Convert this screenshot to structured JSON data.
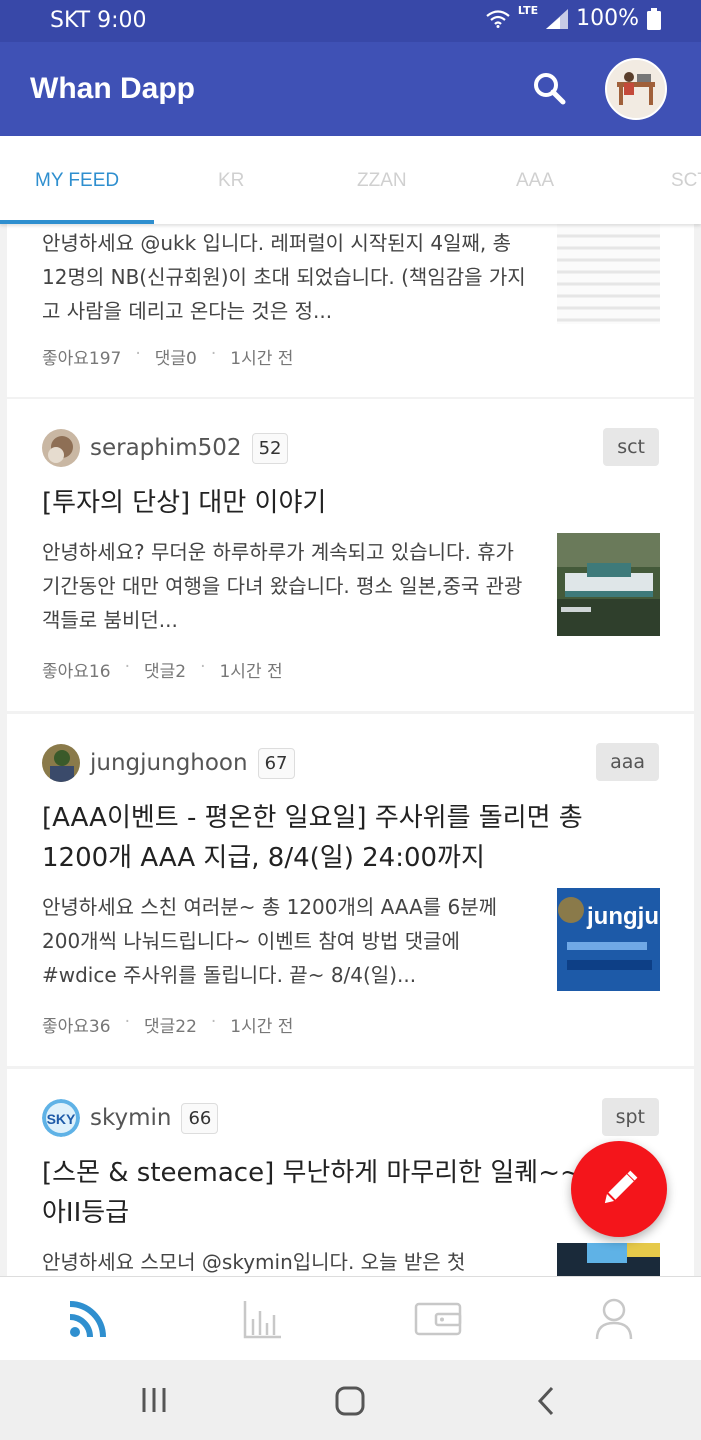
{
  "status": {
    "carrier": "SKT 9:00",
    "network": "LTE",
    "battery": "100%"
  },
  "app": {
    "title": "Whan Dapp"
  },
  "tabs": [
    {
      "label": "MY FEED",
      "active": true
    },
    {
      "label": "KR"
    },
    {
      "label": "ZZAN"
    },
    {
      "label": "AAA"
    },
    {
      "label": "SCT"
    }
  ],
  "posts": [
    {
      "excerpt": "안녕하세요 @ukk 입니다. 레퍼럴이 시작된지 4일째, 총 12명의 NB(신규회원)이 초대 되었습니다. (책임감을 가지고 사람을 데리고 온다는 것은 정...",
      "likes": "좋아요197",
      "comments": "댓글0",
      "time": "1시간 전"
    },
    {
      "author": "seraphim502",
      "rep": "52",
      "tag": "sct",
      "title": "[투자의 단상] 대만 이야기",
      "excerpt": "안녕하세요? 무더운 하루하루가 계속되고 있습니다. 휴가 기간동안 대만 여행을 다녀 왔습니다. 평소 일본,중국 관광객들로 붐비던...",
      "likes": "좋아요16",
      "comments": "댓글2",
      "time": "1시간 전"
    },
    {
      "author": "jungjunghoon",
      "rep": "67",
      "tag": "aaa",
      "title": "[AAA이벤트 - 평온한 일요일] 주사위를 돌리면 총 1200개 AAA 지급, 8/4(일) 24:00까지",
      "excerpt": "안녕하세요 스친 여러분~ 총 1200개의 AAA를 6분께 200개씩 나눠드립니다~ 이벤트 참여 방법 댓글에 #wdice 주사위를 돌립니다. 끝~ 8/4(일)...",
      "likes": "좋아요36",
      "comments": "댓글22",
      "time": "1시간 전",
      "thumb_text": "jungju"
    },
    {
      "author": "skymin",
      "rep": "66",
      "tag": "spt",
      "title": "[스몬 & steemace] 무난하게 마무리한 일퀘~~다이아II등급",
      "excerpt": "안녕하세요 스모너 @skymin입니다. 오늘 받은 첫",
      "avatar_text": "SKY"
    }
  ],
  "colors": {
    "appbar": "#3f51b5",
    "statusbar": "#3848a8",
    "tab_active": "#2f8fcf",
    "fab": "#f4151b"
  },
  "icons": {
    "search": "search-icon",
    "fab": "pencil-icon",
    "nav": [
      "feed-rss-icon",
      "chart-bar-icon",
      "wallet-icon",
      "profile-icon"
    ]
  }
}
